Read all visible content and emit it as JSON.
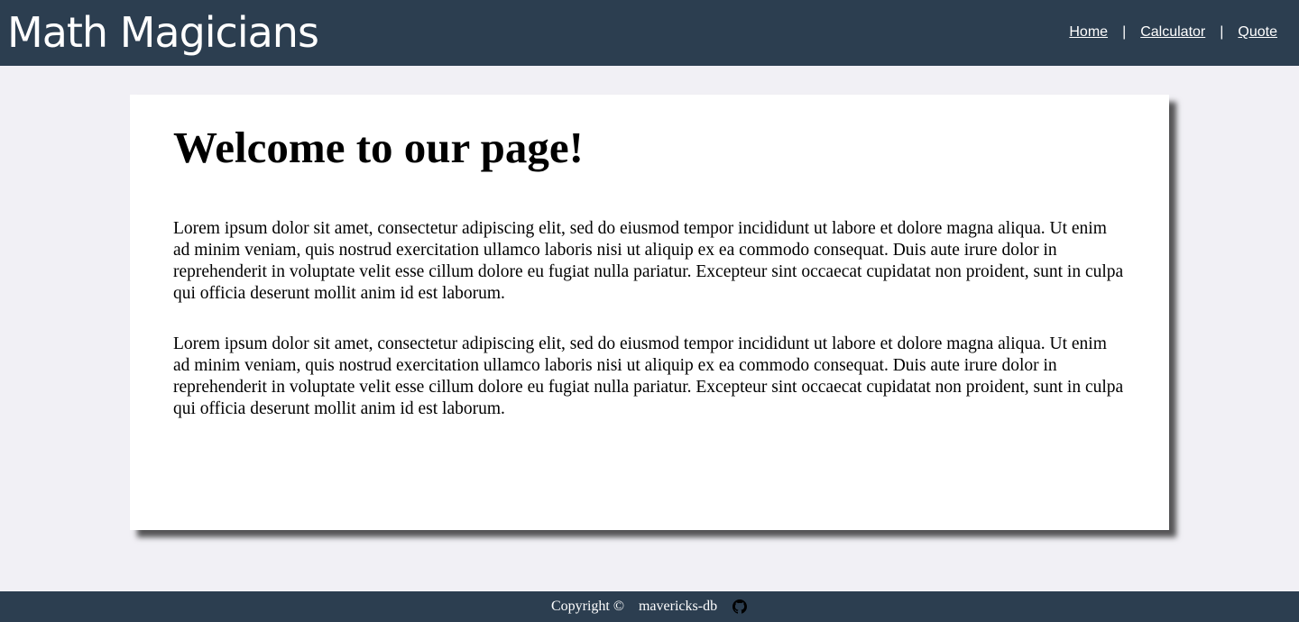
{
  "header": {
    "title": "Math Magicians",
    "nav": {
      "home": "Home",
      "calculator": "Calculator",
      "quote": "Quote",
      "separator": "|"
    }
  },
  "main": {
    "heading": "Welcome to our page!",
    "paragraphs": [
      "Lorem ipsum dolor sit amet, consectetur adipiscing elit, sed do eiusmod tempor incididunt ut labore et dolore magna aliqua. Ut enim ad minim veniam, quis nostrud exercitation ullamco laboris nisi ut aliquip ex ea commodo consequat. Duis aute irure dolor in reprehenderit in voluptate velit esse cillum dolore eu fugiat nulla pariatur. Excepteur sint occaecat cupidatat non proident, sunt in culpa qui officia deserunt mollit anim id est laborum.",
      "Lorem ipsum dolor sit amet, consectetur adipiscing elit, sed do eiusmod tempor incididunt ut labore et dolore magna aliqua. Ut enim ad minim veniam, quis nostrud exercitation ullamco laboris nisi ut aliquip ex ea commodo consequat. Duis aute irure dolor in reprehenderit in voluptate velit esse cillum dolore eu fugiat nulla pariatur. Excepteur sint occaecat cupidatat non proident, sunt in culpa qui officia deserunt mollit anim id est laborum."
    ]
  },
  "footer": {
    "copyright": "Copyright ©",
    "author": "mavericks-db",
    "icon": "github-icon"
  },
  "colors": {
    "header_bg": "#2c3e50",
    "page_bg": "#f1f0f5",
    "card_bg": "#ffffff",
    "text": "#000000"
  }
}
